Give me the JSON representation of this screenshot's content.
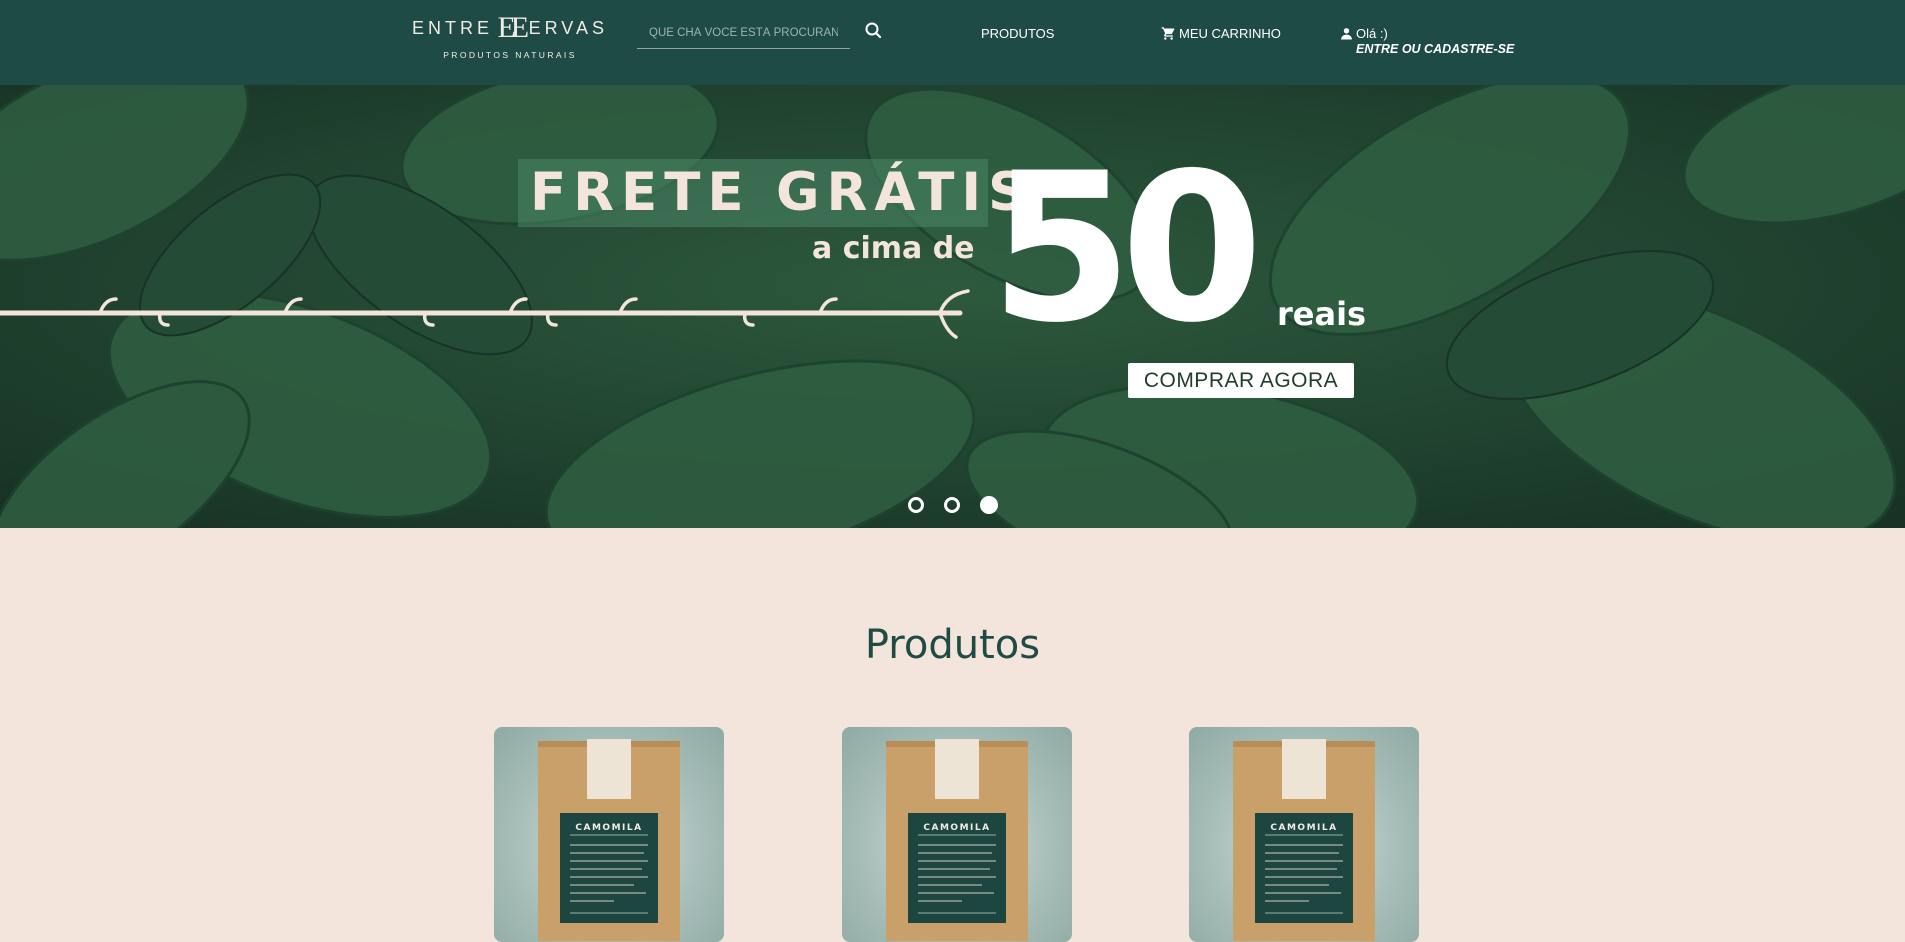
{
  "colors": {
    "header_bg": "#1f4b46",
    "page_bg": "#f4e5dc",
    "accent": "#1f4b46"
  },
  "header": {
    "logo": {
      "left_word": "ENTRE",
      "mark": "EE",
      "right_word": "ERVAS",
      "subtitle": "PRODUTOS NATURAIS"
    },
    "search": {
      "placeholder": "QUE CHÁ VOCÊ ESTÁ PROCURANDO",
      "value": "",
      "icon": "search-icon"
    },
    "nav": {
      "products_label": "PRODUTOS"
    },
    "cart": {
      "label": "MEU CARRINHO",
      "icon": "cart-icon"
    },
    "account": {
      "greeting": "Olá :)",
      "signin_label": "ENTRE OU CADASTRE-SE",
      "icon": "user-icon"
    }
  },
  "hero": {
    "headline": "FRETE GRÁTIS",
    "subline": "a cima de",
    "amount": "50",
    "unit": "reais",
    "cta_label": "COMPRAR AGORA",
    "carousel": {
      "slides": 3,
      "active_index": 3
    }
  },
  "products": {
    "title": "Produtos",
    "items": [
      {
        "name": "CAMOMILA"
      },
      {
        "name": "CAMOMILA"
      },
      {
        "name": "CAMOMILA"
      }
    ]
  }
}
